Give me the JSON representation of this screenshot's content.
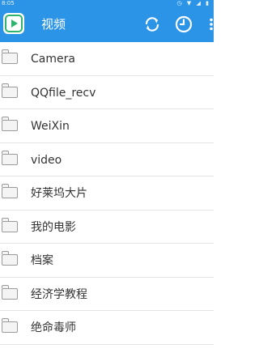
{
  "status_bar": {
    "time": "8:05"
  },
  "header": {
    "title": "视频"
  },
  "folders": [
    {
      "name": "Camera"
    },
    {
      "name": "QQfile_recv"
    },
    {
      "name": "WeiXin"
    },
    {
      "name": "video"
    },
    {
      "name": "好莱坞大片"
    },
    {
      "name": "我的电影"
    },
    {
      "name": "档案"
    },
    {
      "name": "经济学教程"
    },
    {
      "name": "绝命毒师"
    }
  ],
  "colors": {
    "accent": "#2b94e6",
    "divider": "#e3e3e3",
    "text": "#333333"
  }
}
